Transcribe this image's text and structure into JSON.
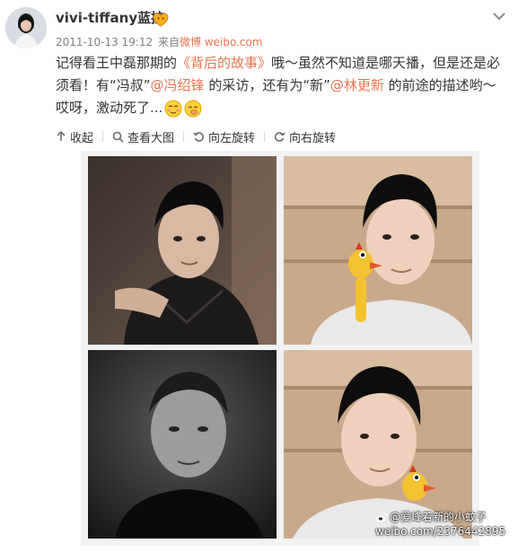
{
  "post": {
    "username": "vivi-tiffany蓝控",
    "timestamp": "2011-10-13 19:12",
    "source_prefix": "来自",
    "source": "微博 weibo.com",
    "text": {
      "part1": "记得看王中磊那期的",
      "link1": "《背后的故事》",
      "part2": "哦～虽然不知道是哪天播，但是还是必须看！有“冯叔”",
      "mention1": "@冯绍锋",
      "part3": " 的采访，还有为“新”",
      "mention2": "@林更新",
      "part4": " 的前途的描述哟～哎呀，激动死了..."
    },
    "icons": {
      "vip": "vip-badge-icon",
      "more": "chevron-down-icon",
      "emoji1": "blush-emoji-icon",
      "emoji2": "giggle-emoji-icon"
    }
  },
  "actions": {
    "collapse": "收起",
    "view_large": "查看大图",
    "rotate_left": "向左旋转",
    "rotate_right": "向右旋转"
  },
  "watermark": {
    "handle": "@爱峰着新的小蚊子",
    "url": "weibo.com/2376442895"
  },
  "colors": {
    "link": "#eb7350",
    "meta": "#808080",
    "text": "#333333"
  }
}
